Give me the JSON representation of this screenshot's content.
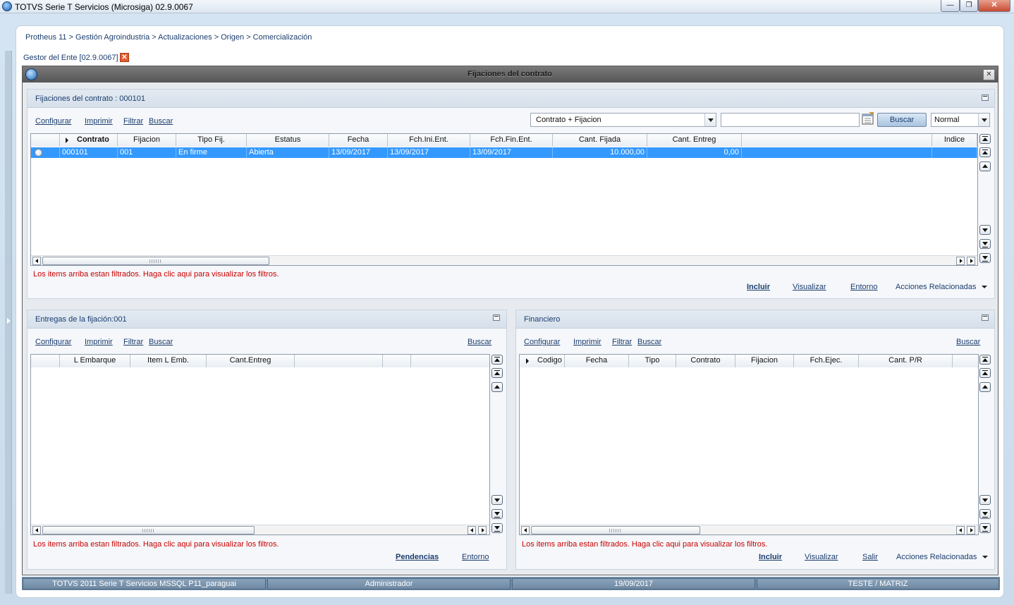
{
  "window": {
    "title": "TOTVS Serie T Servicios (Microsiga) 02.9.0067"
  },
  "breadcrumb": "Protheus 11 > Gestión Agroindustria > Actualizaciones > Origen > Comercialización",
  "tab": {
    "label": "Gestor del Ente [02.9.0067]"
  },
  "dialog": {
    "title": "Fijaciones del contrato"
  },
  "main_panel": {
    "title": "Fijaciones del contrato : 000101",
    "toolbar": {
      "configurar": "Configurar",
      "imprimir": "Imprimir",
      "filtrar": "Filtrar",
      "buscar": "Buscar"
    },
    "index_combo": "Contrato + Fijacion",
    "search_value": "",
    "search_button": "Buscar",
    "mode_combo": "Normal",
    "columns": [
      "Contrato",
      "Fijacion",
      "Tipo Fij.",
      "Estatus",
      "Fecha",
      "Fch.Ini.Ent.",
      "Fch.Fin.Ent.",
      "Cant. Fijada",
      "Cant. Entreg",
      "",
      "Indice"
    ],
    "rows": [
      {
        "contrato": "000101",
        "fijacion": "001",
        "tipo": "En firme",
        "estatus": "Abierta",
        "fecha": "13/09/2017",
        "ini": "13/09/2017",
        "fin": "13/09/2017",
        "fijada": "10.000,00",
        "entreg": "0,00"
      }
    ],
    "filter_msg": "Los items arriba estan filtrados. Haga clic aqui para visualizar los filtros.",
    "actions": {
      "incluir": "Incluir",
      "visualizar": "Visualizar",
      "entorno": "Entorno",
      "acciones": "Acciones Relacionadas"
    }
  },
  "entregas_panel": {
    "title": "Entregas de la fijación:001",
    "toolbar": {
      "configurar": "Configurar",
      "imprimir": "Imprimir",
      "filtrar": "Filtrar",
      "buscar": "Buscar",
      "buscar_right": "Buscar"
    },
    "columns": [
      "",
      "L Embarque",
      "Item L Emb.",
      "Cant.Entreg",
      "",
      ""
    ],
    "filter_msg": "Los items arriba estan filtrados. Haga clic aqui para visualizar los filtros.",
    "actions": {
      "pendencias": "Pendencias",
      "entorno": "Entorno"
    }
  },
  "financiero_panel": {
    "title": "Financiero",
    "toolbar": {
      "configurar": "Configurar",
      "imprimir": "Imprimir",
      "filtrar": "Filtrar",
      "buscar": "Buscar",
      "buscar_right": "Buscar"
    },
    "columns": [
      "Codigo",
      "Fecha",
      "Tipo",
      "Contrato",
      "Fijacion",
      "Fch.Ejec.",
      "Cant. P/R"
    ],
    "filter_msg": "Los items arriba estan filtrados. Haga clic aqui para visualizar los filtros.",
    "actions": {
      "incluir": "Incluir",
      "visualizar": "Visualizar",
      "salir": "Salir",
      "acciones": "Acciones Relacionadas"
    }
  },
  "statusbar": {
    "system": "TOTVS 2011 Serie T Servicios MSSQL P11_paraguai",
    "user": "Administrador",
    "date": "19/09/2017",
    "branch": "TESTE / MATRIZ"
  }
}
